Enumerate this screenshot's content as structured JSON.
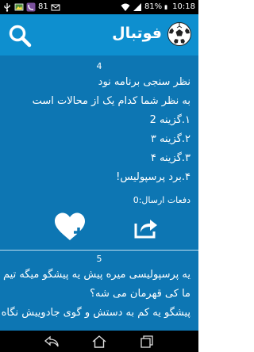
{
  "status_bar": {
    "notification_count": "81",
    "battery_percent": "81%",
    "time": "10:18"
  },
  "app_bar": {
    "title": "فوتبال",
    "logo_icon": "soccer-ball-icon",
    "search_icon": "search-icon",
    "background": "#0e8fcf"
  },
  "posts": [
    {
      "number": "4",
      "lines": [
        "نظر سنجی برنامه نود",
        "به نظر شما کدام یک از محالات است",
        "۱.گزینه 2",
        "۲.گزینه ۳",
        "۳.گزینه ۴",
        "۴.برد پرسپولیس!"
      ],
      "sent_label": "دفعات ارسال:0",
      "like_icon": "heart-plus-icon",
      "share_icon": "share-icon"
    },
    {
      "number": "5",
      "lines": [
        "یه پرسپولیسی میره پیش یه پیشگو میگه تیم",
        "ما کی قهرمان می شه؟",
        "پیشگو یه کم به دستش و گوی جادوییش نگاه"
      ]
    }
  ],
  "content_background": "#0d76b3",
  "nav_bar": {
    "back_icon": "back-icon",
    "home_icon": "home-icon",
    "recents_icon": "recent-apps-icon"
  }
}
